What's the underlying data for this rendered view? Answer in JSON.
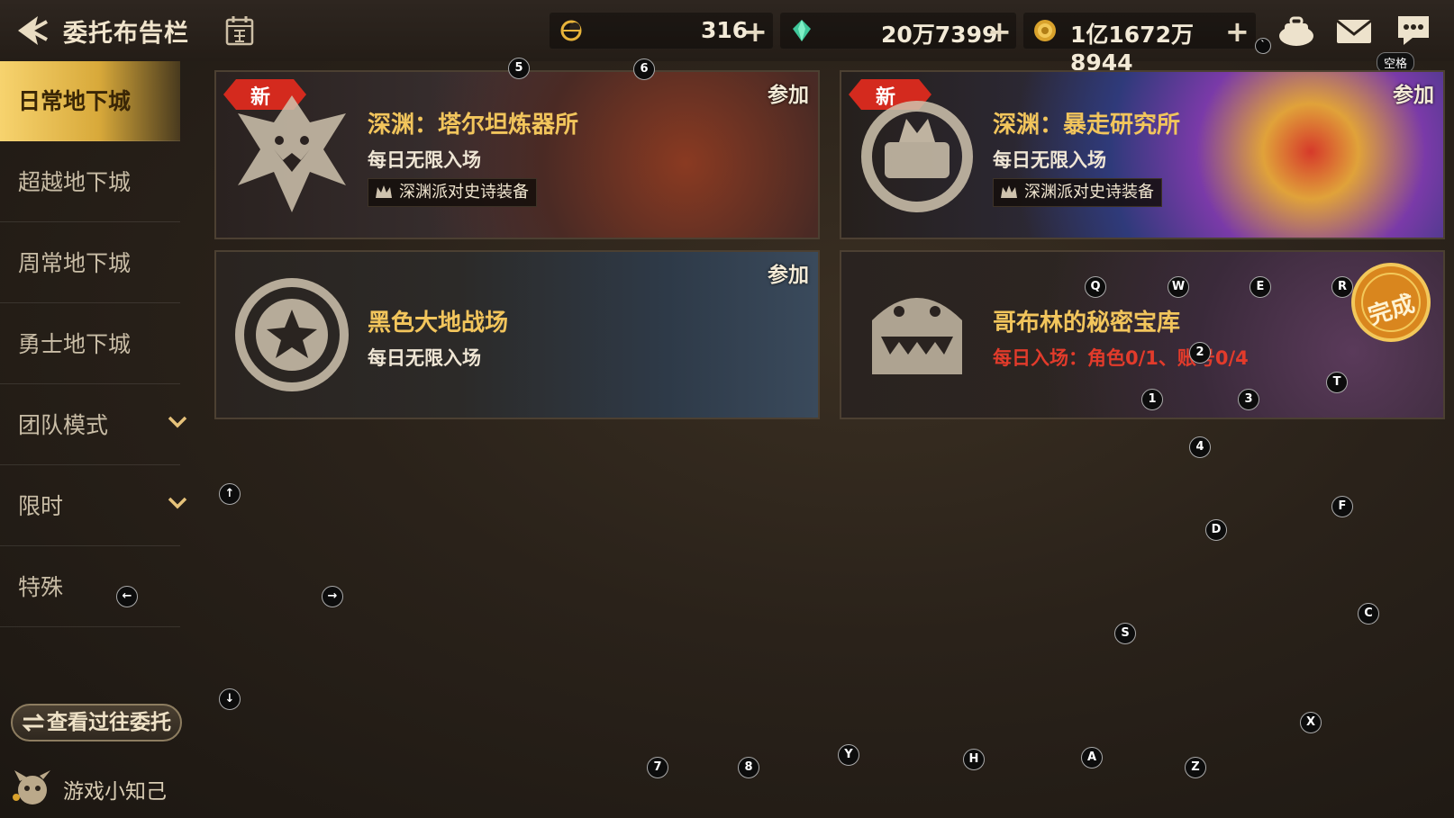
{
  "header": {
    "title": "委托布告栏",
    "resources": [
      {
        "icon": "fatigue-moon-icon",
        "value": "316"
      },
      {
        "icon": "crystal-icon",
        "value": "20万7399"
      },
      {
        "icon": "gold-coin-icon",
        "value": "1亿1672万8944"
      }
    ],
    "plus": "+",
    "space_key_label": "空格"
  },
  "sidebar": {
    "items": [
      {
        "label": "日常地下城",
        "active": true
      },
      {
        "label": "超越地下城"
      },
      {
        "label": "周常地下城"
      },
      {
        "label": "勇士地下城"
      },
      {
        "label": "团队模式",
        "expandable": true
      },
      {
        "label": "限时",
        "expandable": true
      },
      {
        "label": "特殊"
      }
    ],
    "history_button": "查看过往委托",
    "tips_label": "游戏小知己"
  },
  "cards": [
    {
      "name": "深渊：塔尔坦炼器所",
      "subtitle": "每日无限入场",
      "tag": "深渊派对史诗装备",
      "badge": "新",
      "action": "参加"
    },
    {
      "name": "深渊：暴走研究所",
      "subtitle": "每日无限入场",
      "tag": "深渊派对史诗装备",
      "badge": "新",
      "action": "参加"
    },
    {
      "name": "黑色大地战场",
      "subtitle": "每日无限入场",
      "action": "参加"
    },
    {
      "name": "哥布林的秘密宝库",
      "subtitle": "每日入场：角色0/1、账号0/4",
      "stamp": "完成"
    }
  ],
  "key_hints": [
    "5",
    "6",
    "Q",
    "W",
    "E",
    "R",
    "2",
    "T",
    "1",
    "3",
    "4",
    "F",
    "D",
    "C",
    "S",
    "X",
    "Y",
    "H",
    "A",
    "Z",
    "7",
    "8",
    "↑",
    "←",
    "→",
    "↓",
    "`"
  ],
  "colors": {
    "accent_gold": "#f2c55c",
    "active_tab": "#e6b84a",
    "new_badge": "#d42a1e",
    "warning_text": "#e23b2b"
  }
}
